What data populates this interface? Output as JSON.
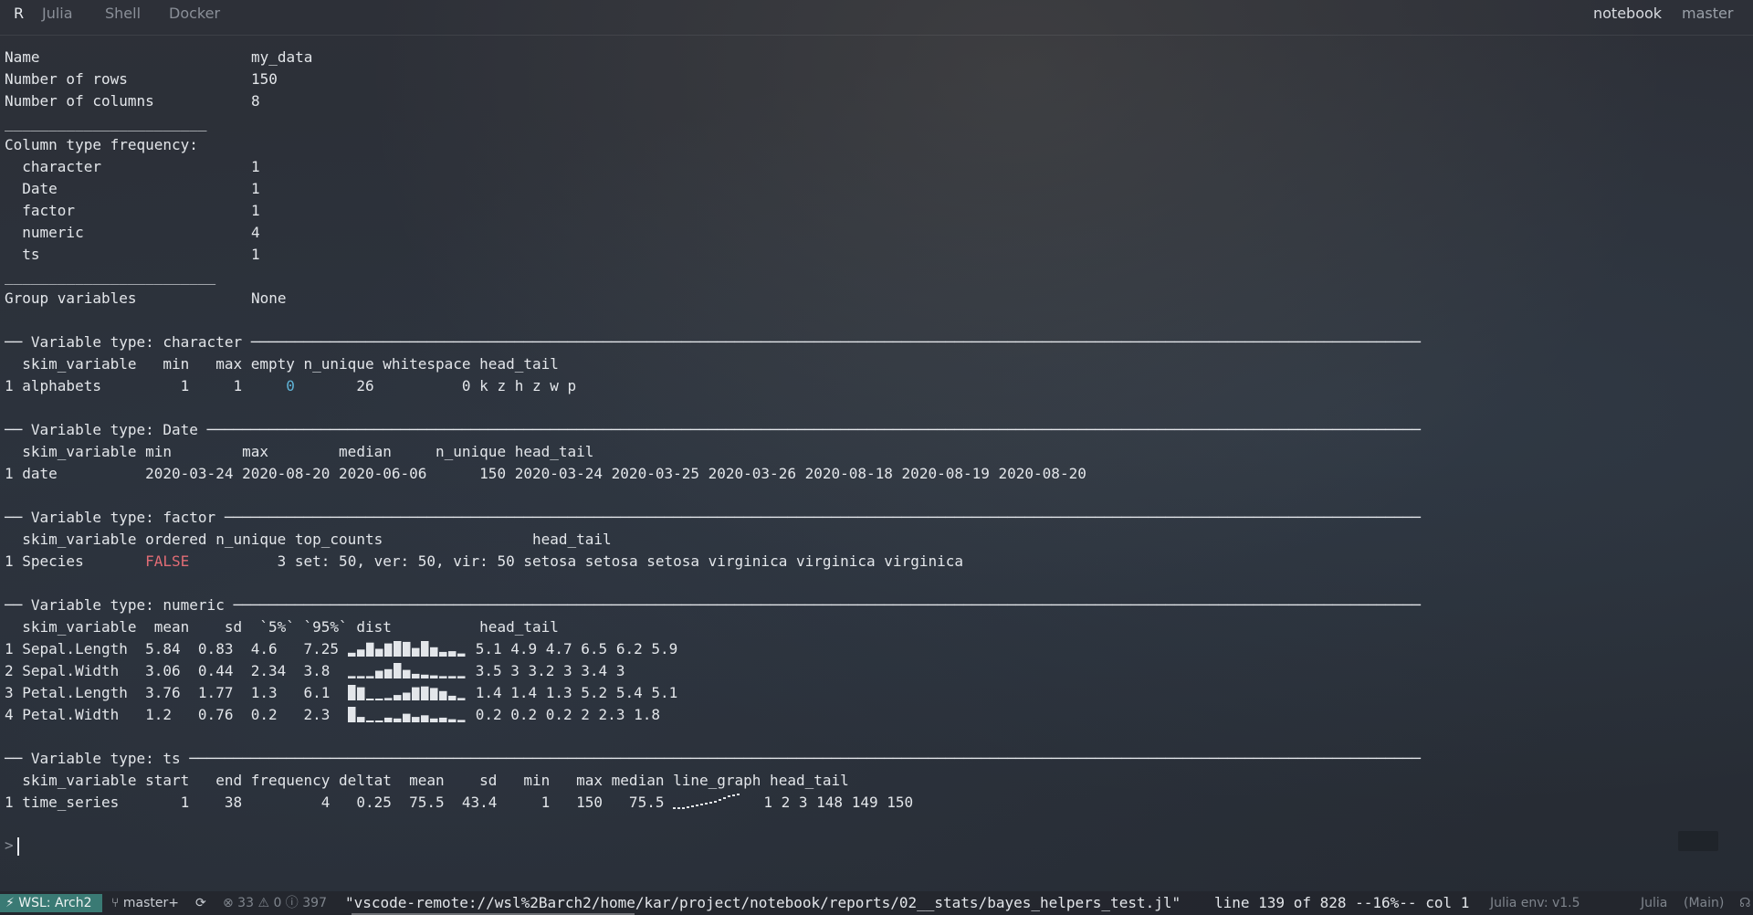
{
  "tabs": [
    {
      "label": "R"
    },
    {
      "label": "Julia"
    },
    {
      "label": "Shell"
    },
    {
      "label": "Docker"
    }
  ],
  "top_right": {
    "notebook": "notebook",
    "branch": "master"
  },
  "summary": {
    "name_label": "Name",
    "name_value": "my_data",
    "rows_label": "Number of rows",
    "rows_value": "150",
    "cols_label": "Number of columns",
    "cols_value": "8",
    "rule1": "_______________________",
    "type_freq_label": "Column type frequency:",
    "types": [
      {
        "name": "character",
        "count": "1"
      },
      {
        "name": "Date",
        "count": "1"
      },
      {
        "name": "factor",
        "count": "1"
      },
      {
        "name": "numeric",
        "count": "4"
      },
      {
        "name": "ts",
        "count": "1"
      }
    ],
    "rule2": "________________________",
    "group_label": "Group variables",
    "group_value": "None"
  },
  "sections": {
    "character": {
      "header": "── Variable type: character ─────────────────────────────────────────────────────────────────────────────────────────────────────────────────────────────────────",
      "cols": "  skim_variable   min   max empty n_unique whitespace head_tail",
      "row": {
        "pre": "1 alphabets         1     1     ",
        "empty": "0",
        "post": "       26          0 k z h z w p"
      }
    },
    "date": {
      "header": "── Variable type: Date ──────────────────────────────────────────────────────────────────────────────────────────────────────────────────────────────────────────",
      "cols": "  skim_variable min        max        median     n_unique head_tail",
      "row": "1 date          2020-03-24 2020-08-20 2020-06-06      150 2020-03-24 2020-03-25 2020-03-26 2020-08-18 2020-08-19 2020-08-20"
    },
    "factor": {
      "header": "── Variable type: factor ────────────────────────────────────────────────────────────────────────────────────────────────────────────────────────────────────────",
      "cols": "  skim_variable ordered n_unique top_counts                 head_tail",
      "row": {
        "pre": "1 Species       ",
        "ordered": "FALSE",
        "post": "          3 set: 50, ver: 50, vir: 50 setosa setosa setosa virginica virginica virginica"
      }
    },
    "numeric": {
      "header": "── Variable type: numeric ───────────────────────────────────────────────────────────────────────────────────────────────────────────────────────────────────────",
      "cols": "  skim_variable  mean    sd  `5%` `95%` dist          head_tail",
      "rows": [
        {
          "pre": "1 Sepal.Length  5.84  0.83  4.6   7.25 ",
          "dist": [
            0.25,
            0.45,
            0.9,
            0.5,
            0.85,
            1,
            0.95,
            0.55,
            1,
            0.6,
            0.3,
            0.35,
            0.2
          ],
          "post": "5.1 4.9 4.7 6.5 6.2 5.9"
        },
        {
          "pre": "2 Sepal.Width   3.06  0.44  2.34  3.8  ",
          "dist": [
            0.15,
            0.15,
            0.15,
            0.5,
            0.6,
            1,
            0.55,
            0.3,
            0.25,
            0.2,
            0.15,
            0.15,
            0.15
          ],
          "post": "3.5 3 3.2 3 3.4 3"
        },
        {
          "pre": "3 Petal.Length  3.76  1.77  1.3   6.1  ",
          "dist": [
            1,
            0.85,
            0.1,
            0.1,
            0.15,
            0.35,
            0.5,
            0.85,
            0.9,
            0.8,
            0.6,
            0.3,
            0.15
          ],
          "post": "1.4 1.4 1.3 5.2 5.4 5.1"
        },
        {
          "pre": "4 Petal.Width   1.2   0.76  0.2   2.3  ",
          "dist": [
            1,
            0.35,
            0.1,
            0.1,
            0.3,
            0.25,
            0.55,
            0.35,
            0.45,
            0.25,
            0.3,
            0.2,
            0.15
          ],
          "post": "0.2 0.2 0.2 2 2.3 1.8"
        }
      ]
    },
    "ts": {
      "header": "── Variable type: ts ────────────────────────────────────────────────────────────────────────────────────────────────────────────────────────────────────────────",
      "cols": "  skim_variable start   end frequency deltat  mean    sd   min   max median line_graph head_tail",
      "row": {
        "pre": "1 time_series       1    38         4   0.25  75.5  43.4     1   150   75.5 ",
        "post": "  1 2 3 148 149 150"
      }
    }
  },
  "prompt": {
    "symbol": ">"
  },
  "status": {
    "remote": "WSL: Arch2",
    "branch": "master+",
    "sync_icon": "⟳",
    "problems": "⊗ 33 ⚠ 0 ⓘ 397",
    "file": "\"vscode-remote://wsl%2Barch2/home/kar/project/notebook/reports/02__stats/bayes_helpers_test.jl\"",
    "position": "line 139 of 828 --16%-- col 1",
    "julia_env": "Julia env: v1.5",
    "language": "Julia",
    "mode": "(Main)"
  }
}
